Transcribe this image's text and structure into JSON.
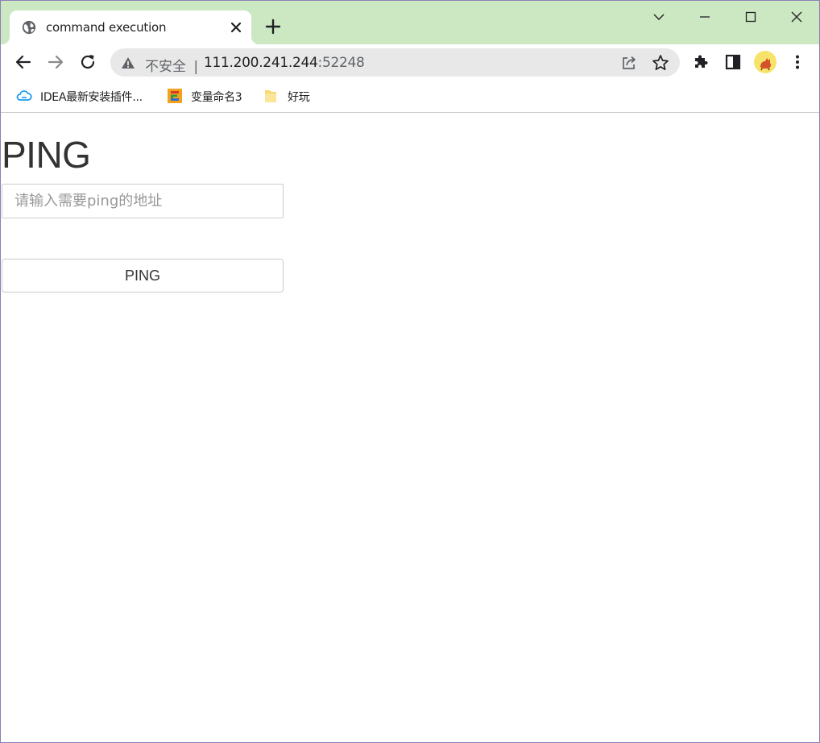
{
  "tab": {
    "title": "command execution"
  },
  "omnibox": {
    "security_label": "不安全",
    "separator": "|",
    "host": "111.200.241.244",
    "port": ":52248"
  },
  "bookmarks": [
    {
      "label": "IDEA最新安装插件...",
      "icon": "cloud-icon"
    },
    {
      "label": "变量命名3",
      "icon": "codelf-icon"
    },
    {
      "label": "好玩",
      "icon": "folder-icon"
    }
  ],
  "page": {
    "title": "PING",
    "input_placeholder": "请输入需要ping的地址",
    "button_label": "PING"
  },
  "colors": {
    "tabstrip_bg": "#cbe8c2",
    "omnibox_bg": "#e8e8e8",
    "text": "#333333",
    "border": "#cccccc"
  }
}
